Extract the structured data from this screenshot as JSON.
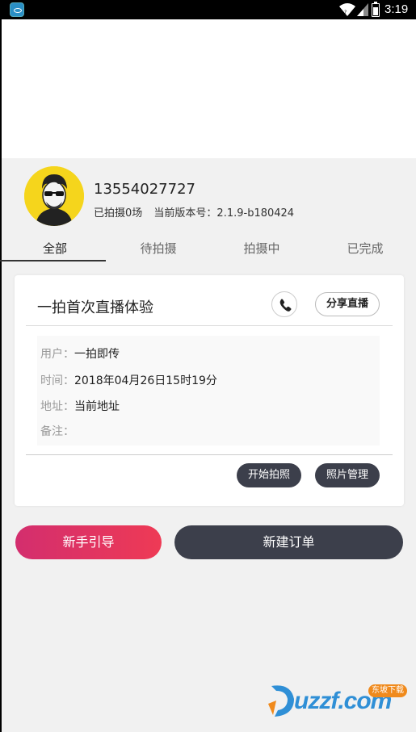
{
  "status_bar": {
    "time": "3:19"
  },
  "profile": {
    "phone": "13554027727",
    "shot_count": "已拍摄0场",
    "version": "当前版本号：2.1.9-b180424"
  },
  "tabs": [
    {
      "label": "全部",
      "active": true
    },
    {
      "label": "待拍摄",
      "active": false
    },
    {
      "label": "拍摄中",
      "active": false
    },
    {
      "label": "已完成",
      "active": false
    }
  ],
  "order_card": {
    "title": "一拍首次直播体验",
    "share_label": "分享直播",
    "details": [
      {
        "label": "用户：",
        "value": "一拍即传"
      },
      {
        "label": "时间：",
        "value": "2018年04月26日15时19分"
      },
      {
        "label": "地址：",
        "value": "当前地址"
      },
      {
        "label": "备注：",
        "value": ""
      }
    ],
    "start_label": "开始拍照",
    "photos_label": "照片管理"
  },
  "actions": {
    "guide_label": "新手引导",
    "new_order_label": "新建订单"
  },
  "watermark": {
    "text": "uzzf.com",
    "tag": "东坡下载"
  },
  "colors": {
    "avatar_bg": "#f5d51c",
    "dark_button": "#3c3f4b",
    "guide_gradient_start": "#d32e6e",
    "guide_gradient_end": "#ee3a55"
  },
  "icons": [
    "app-icon",
    "wifi-icon",
    "signal-icon",
    "battery-icon",
    "phone-icon"
  ]
}
